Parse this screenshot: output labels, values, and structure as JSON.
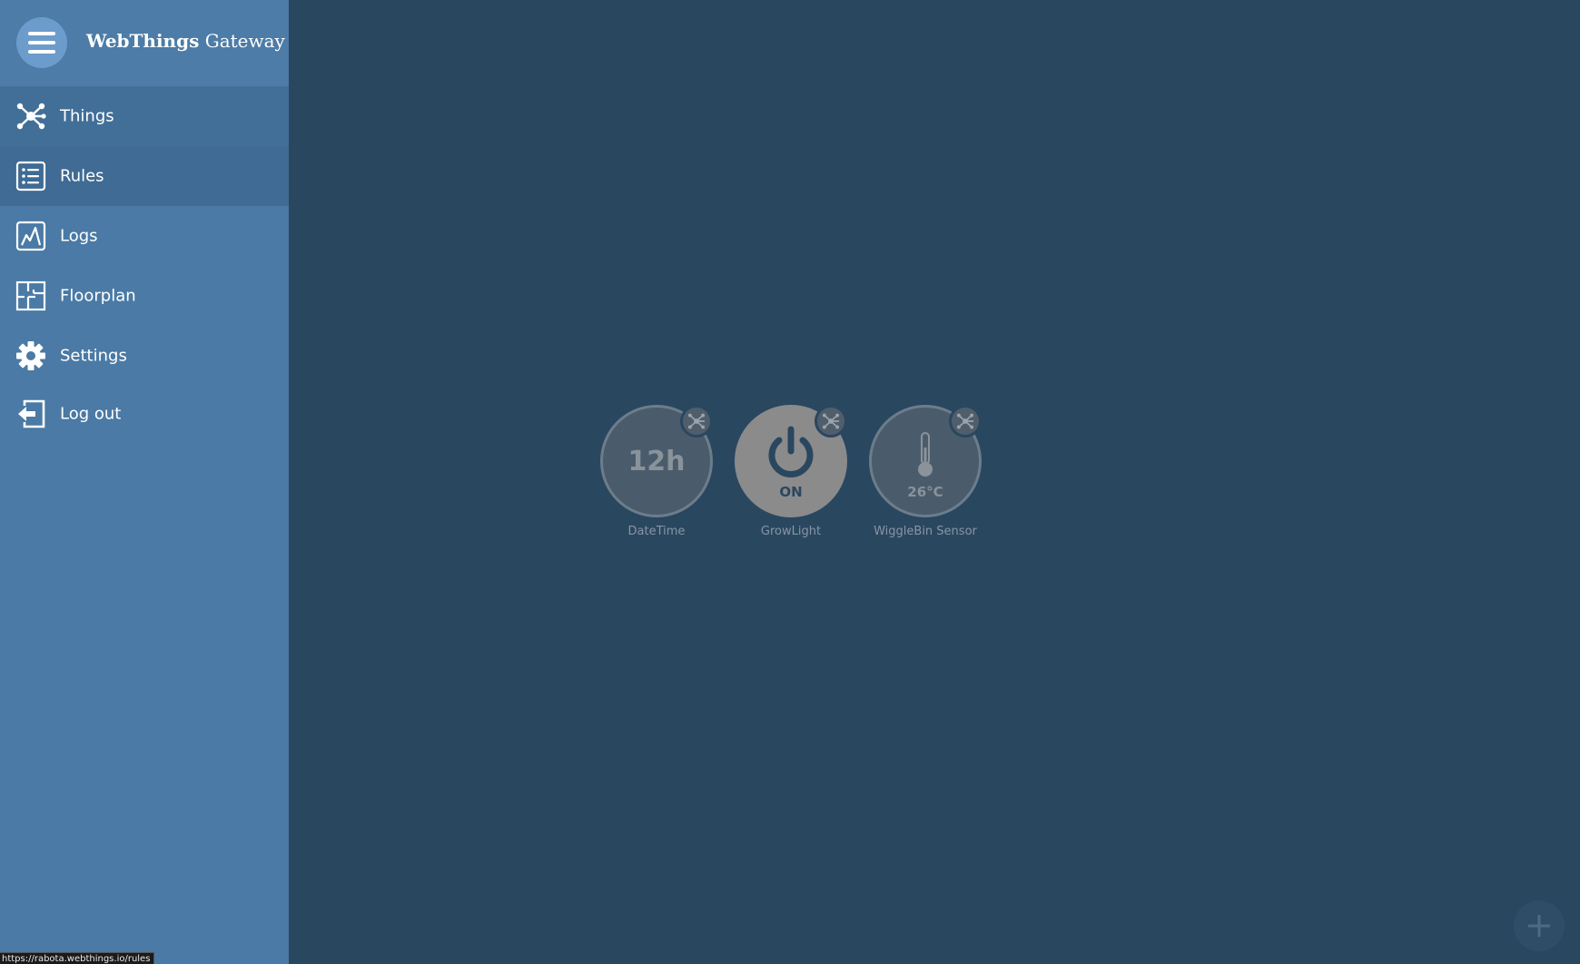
{
  "app": {
    "brand_bold": "WebThings",
    "brand_light": "Gateway"
  },
  "sidebar": {
    "items": [
      {
        "label": "Things",
        "icon": "things-icon"
      },
      {
        "label": "Rules",
        "icon": "rules-icon"
      },
      {
        "label": "Logs",
        "icon": "logs-icon"
      },
      {
        "label": "Floorplan",
        "icon": "floorplan-icon"
      },
      {
        "label": "Settings",
        "icon": "gear-icon"
      },
      {
        "label": "Log out",
        "icon": "logout-icon"
      }
    ]
  },
  "things": [
    {
      "name": "DateTime",
      "value": "12h",
      "state": "off",
      "icon": "clock-icon"
    },
    {
      "name": "GrowLight",
      "value": "ON",
      "state": "on",
      "icon": "power-icon"
    },
    {
      "name": "WiggleBin Sensor",
      "value": "26°C",
      "state": "off",
      "icon": "thermometer-icon"
    }
  ],
  "status_bar": {
    "url": "https://rabota.webthings.io/rules"
  },
  "colors": {
    "sidebar": "#4a7aa5",
    "background": "#2a4760",
    "thing_on": "#8b8b8b",
    "thing_off": "#4a5c6c"
  }
}
